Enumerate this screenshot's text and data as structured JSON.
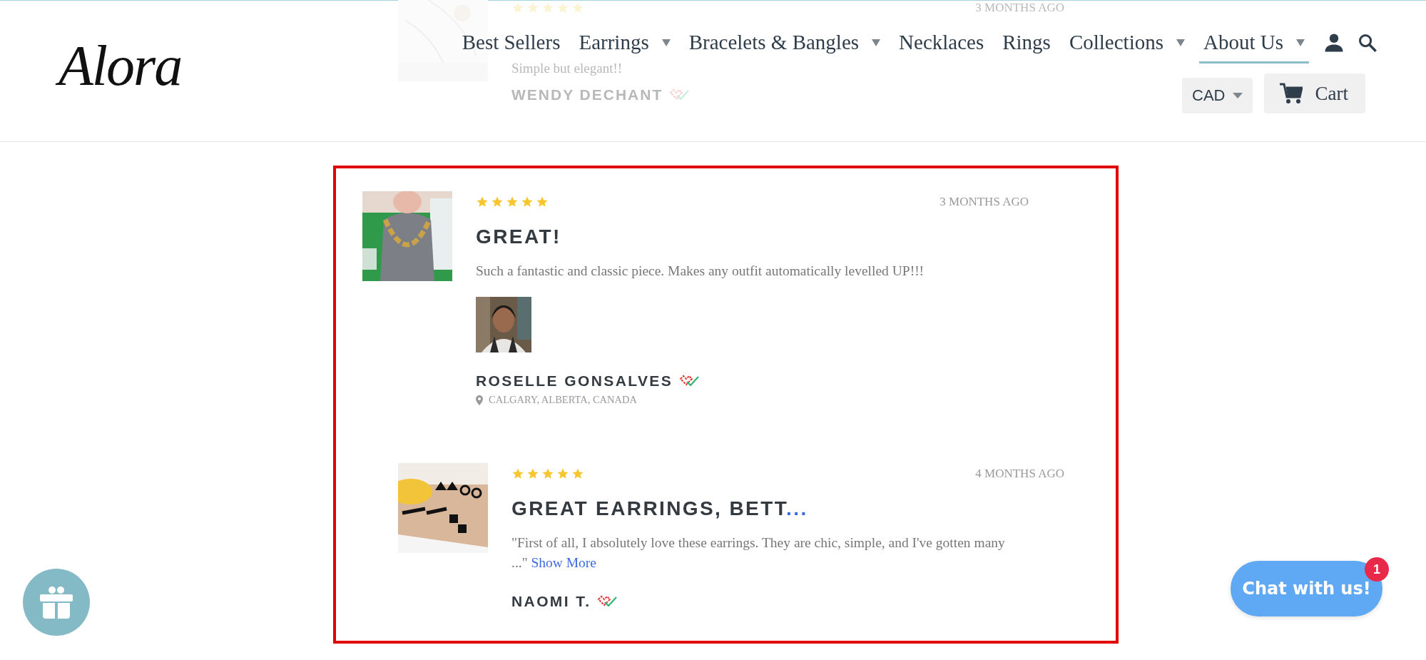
{
  "logo": {
    "text": "Alora"
  },
  "nav": [
    {
      "label": "Best Sellers",
      "dropdown": false,
      "selected": false
    },
    {
      "label": "Earrings",
      "dropdown": true,
      "selected": false
    },
    {
      "label": "Bracelets & Bangles",
      "dropdown": true,
      "selected": false
    },
    {
      "label": "Necklaces",
      "dropdown": false,
      "selected": false
    },
    {
      "label": "Rings",
      "dropdown": false,
      "selected": false
    },
    {
      "label": "Collections",
      "dropdown": true,
      "selected": false
    },
    {
      "label": "About Us",
      "dropdown": true,
      "selected": true
    }
  ],
  "header_actions": {
    "currency": "CAD",
    "cart": "Cart"
  },
  "background_review": {
    "stars": 5,
    "date": "3 MONTHS AGO",
    "body": "Simple but elegant!!",
    "author": "WENDY DECHANT",
    "verified": true
  },
  "reviews": [
    {
      "stars": 5,
      "date": "3 MONTHS AGO",
      "title": "GREAT!",
      "body": "Such a fantastic and classic piece. Makes any outfit automatically levelled UP!!!",
      "author": "ROSELLE GONSALVES",
      "verified": true,
      "location": "CALGARY, ALBERTA, CANADA"
    },
    {
      "stars": 5,
      "date": "4 MONTHS AGO",
      "title": "GREAT EARRINGS, BETT",
      "title_more": "...",
      "body": "\"First of all, I absolutely love these earrings. They are chic, simple, and I've gotten many ...\"",
      "show_more": "Show More",
      "author": "NAOMI T.",
      "verified": true
    }
  ],
  "chat": {
    "label": "Chat with us!",
    "badge": "1"
  },
  "gift_button": {
    "kind": "gift"
  }
}
